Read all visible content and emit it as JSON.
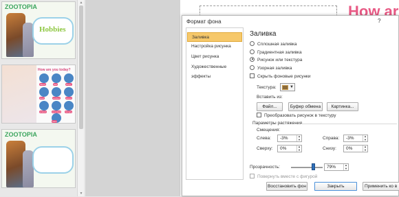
{
  "thumbnails": {
    "brand": "ZOOTOPIA",
    "slide1_title": "Hobbies",
    "slide2_title": "How are you today?",
    "mood_labels": [
      "happy",
      "sad",
      "angry",
      "tired",
      "excited",
      "bored",
      "scared",
      "surprised",
      "hungry",
      "calm"
    ]
  },
  "slide_title_partial": "How ar",
  "dialog": {
    "title": "Формат фона",
    "help": "?",
    "nav": [
      "Заливка",
      "Настройка рисунка",
      "Цвет рисунка",
      "Художественные эффекты"
    ],
    "pane_title": "Заливка",
    "fill_options": [
      "Сплошная заливка",
      "Градиентная заливка",
      "Рисунок или текстура",
      "Узорная заливка"
    ],
    "fill_selected_index": 2,
    "hide_bg_label": "Скрыть фоновые рисунки",
    "hide_bg_checked": false,
    "texture_label": "Текстура:",
    "insert_from_label": "Вставить из:",
    "btn_file": "Файл...",
    "btn_clipboard": "Буфер обмена",
    "btn_clipart": "Картинка...",
    "tile_label": "Преобразовать рисунок в текстуру",
    "tile_checked": false,
    "stretch_params_label": "Параметры растяжения",
    "offsets_label": "Смещения:",
    "offset_left_label": "Слева:",
    "offset_left": "-3%",
    "offset_right_label": "Справа:",
    "offset_right": "-3%",
    "offset_top_label": "Сверху:",
    "offset_top": "0%",
    "offset_bottom_label": "Снизу:",
    "offset_bottom": "0%",
    "transparency_label": "Прозрачность:",
    "transparency_value": "79%",
    "transparency_level": 0.79,
    "rotate_label": "Повернуть вместе с фигурой",
    "btn_reset": "Восстановить фон",
    "btn_close": "Закрыть",
    "btn_apply_all": "Применить ко в"
  },
  "colors": {
    "accent_nav": "#f6c86a",
    "slide_title": "#e85a85",
    "slider": "#2f6fb7"
  }
}
